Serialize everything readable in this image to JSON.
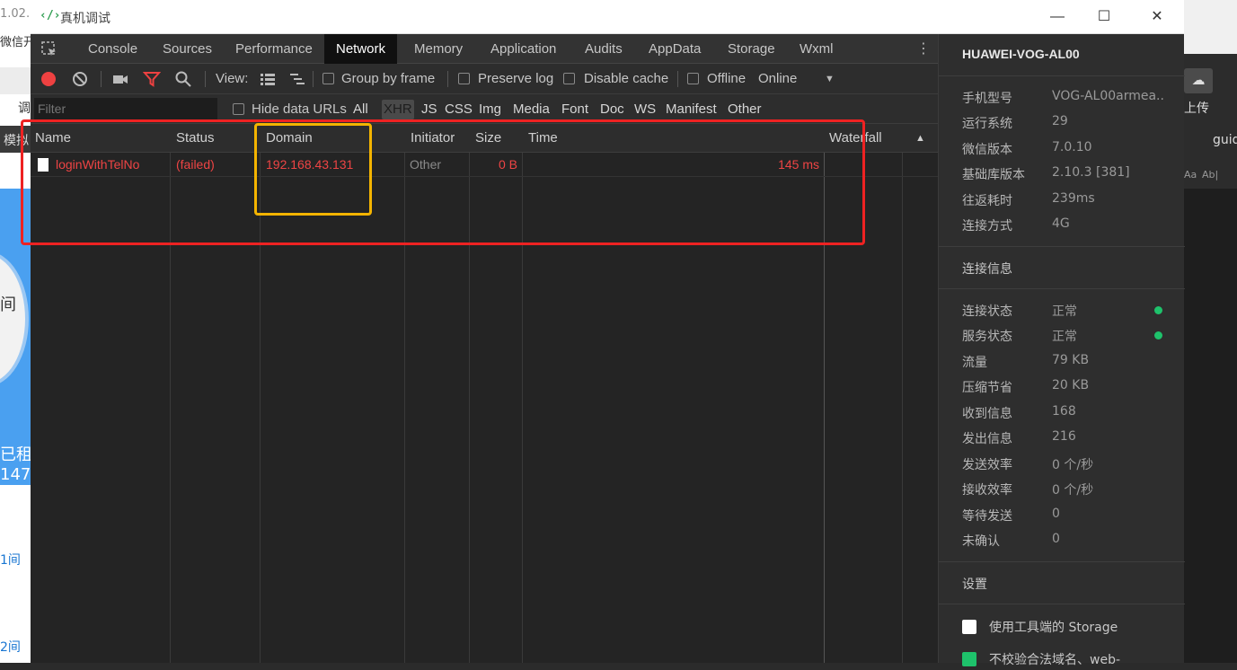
{
  "window": {
    "title": "真机调试",
    "logo": "‹/›"
  },
  "tabs": [
    "Console",
    "Sources",
    "Performance",
    "Network",
    "Memory",
    "Application",
    "Audits",
    "AppData",
    "Storage",
    "Wxml"
  ],
  "active_tab": "Network",
  "toolbar": {
    "view_label": "View:",
    "group_by_frame": "Group by frame",
    "preserve_log": "Preserve log",
    "disable_cache": "Disable cache",
    "offline": "Offline",
    "throttle": "Online"
  },
  "filterbar": {
    "placeholder": "Filter",
    "hide_data_urls": "Hide data URLs",
    "types": [
      "All",
      "XHR",
      "JS",
      "CSS",
      "Img",
      "Media",
      "Font",
      "Doc",
      "WS",
      "Manifest",
      "Other"
    ],
    "selected_type": "XHR"
  },
  "columns": [
    "Name",
    "Status",
    "Domain",
    "Initiator",
    "Size",
    "Time",
    "Waterfall"
  ],
  "requests": [
    {
      "name": "loginWithTelNo",
      "status": "(failed)",
      "domain": "192.168.43.131",
      "initiator": "Other",
      "size": "0 B",
      "time": "145 ms"
    }
  ],
  "panel": {
    "device": "HUAWEI-VOG-AL00",
    "info": [
      {
        "k": "手机型号",
        "v": "VOG-AL00armea..."
      },
      {
        "k": "运行系统",
        "v": "29"
      },
      {
        "k": "微信版本",
        "v": "7.0.10"
      },
      {
        "k": "基础库版本",
        "v": "2.10.3 [381]"
      },
      {
        "k": "往返耗时",
        "v": "239ms"
      },
      {
        "k": "连接方式",
        "v": "4G"
      }
    ],
    "conn_title": "连接信息",
    "conn": [
      {
        "k": "连接状态",
        "v": "正常"
      },
      {
        "k": "服务状态",
        "v": "正常"
      },
      {
        "k": "流量",
        "v": "79 KB"
      },
      {
        "k": "压缩节省",
        "v": "20 KB"
      },
      {
        "k": "收到信息",
        "v": "168"
      },
      {
        "k": "发出信息",
        "v": "216"
      },
      {
        "k": "发送效率",
        "v": "0 个/秒"
      },
      {
        "k": "接收效率",
        "v": "0 个/秒"
      },
      {
        "k": "等待发送",
        "v": "0"
      },
      {
        "k": "未确认",
        "v": "0"
      }
    ],
    "settings_title": "设置",
    "settings": [
      {
        "label": "使用工具端的 Storage"
      },
      {
        "label": "不校验合法域名、web-"
      }
    ]
  },
  "background": {
    "left_texts": [
      "1.02.",
      "微信开",
      "调",
      "模拟",
      "间",
      "已租",
      "147",
      "1间",
      "2间"
    ],
    "right_texts": [
      "上传",
      "guid",
      "Aa",
      "Ab|"
    ]
  },
  "colors": {
    "accent_red": "#ee4444",
    "highlight_red": "#ee2222",
    "highlight_yellow": "#f4b400",
    "status_green": "#1ec26b"
  }
}
